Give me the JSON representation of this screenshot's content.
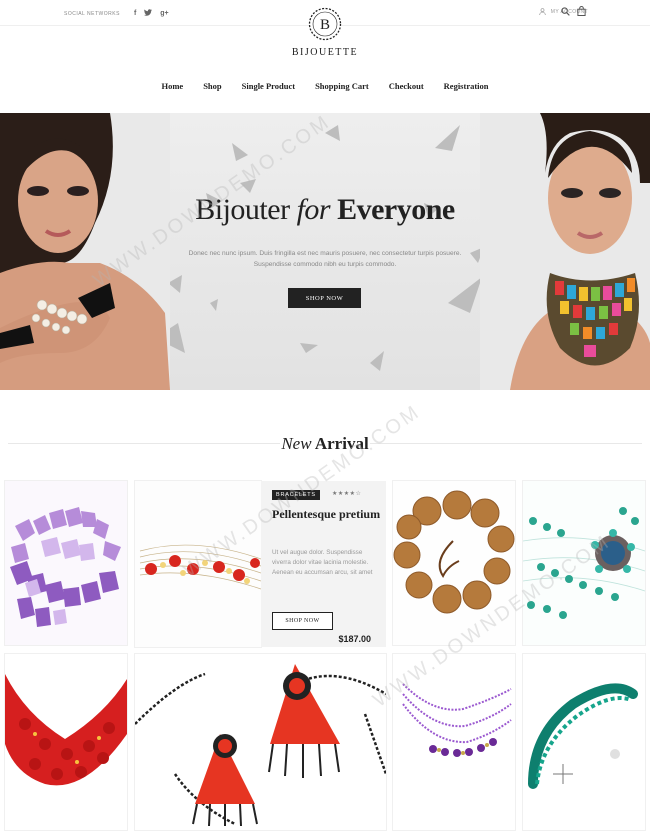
{
  "topbar": {
    "social_label": "SOCIAL NETWORKS",
    "social_icons": [
      "facebook-icon",
      "twitter-icon",
      "google-plus-icon"
    ],
    "social_glyphs": [
      "f",
      "✓",
      "g+"
    ],
    "account_label": "MY ACCOUNT"
  },
  "brand": {
    "name": "BIJOUETTE",
    "monogram": "B"
  },
  "nav": [
    "Home",
    "Shop",
    "Single Product",
    "Shopping Cart",
    "Checkout",
    "Registration"
  ],
  "hero": {
    "title_regular": "Bijouter",
    "title_italic": "for",
    "title_bold": "Everyone",
    "description": "Donec nec nunc ipsum. Duis fringilla est nec mauris posuere, nec consectetur turpis posuere. Suspendisse commodo nibh eu turpis commodo.",
    "button": "SHOP NOW"
  },
  "section": {
    "title_italic": "New",
    "title_bold": "Arrival"
  },
  "featured_product": {
    "category": "BRACELETS",
    "rating": 4,
    "stars": "★★★★☆",
    "name": "Pellentesque pretium",
    "description": "Ut vel augue dolor. Suspendisse viverra dolor vitae lacinia molestie. Aenean eu accumsan arcu, sit amet",
    "button": "SHOP NOW",
    "price": "$187.00"
  },
  "products": [
    {
      "name": "purple-crystal-bracelet"
    },
    {
      "name": "red-bead-wire-necklace"
    },
    {
      "name": "wooden-bead-bracelet"
    },
    {
      "name": "turquoise-ring-necklace"
    },
    {
      "name": "red-bead-necklace"
    },
    {
      "name": "beaded-rose-earrings"
    },
    {
      "name": "purple-bead-necklace"
    },
    {
      "name": "green-rope-necklace"
    }
  ],
  "watermark": "WWW.DOWNDEMO.COM",
  "colors": {
    "text": "#222222",
    "muted": "#999999",
    "button": "#222222",
    "hero_bg": "#ebebeb"
  }
}
